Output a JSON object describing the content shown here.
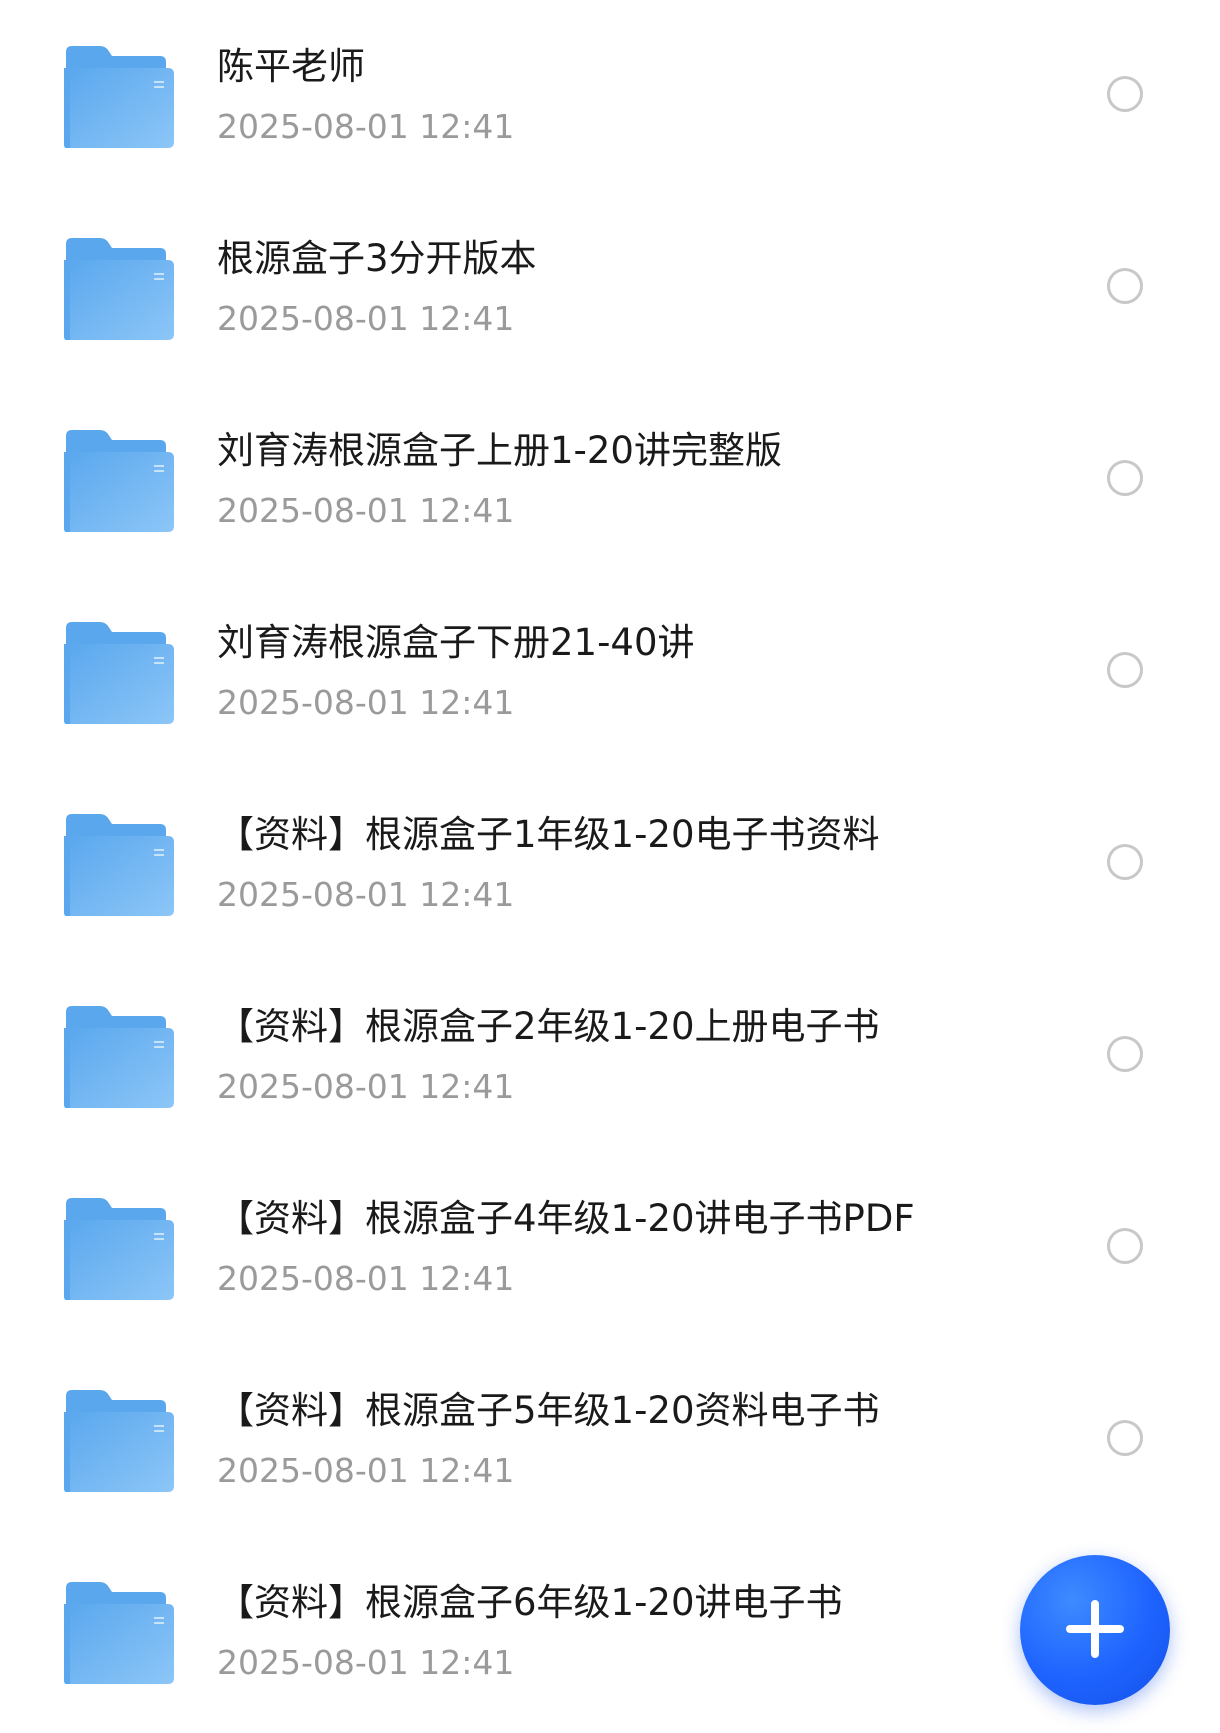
{
  "colors": {
    "folder_back": "#5aa7ee",
    "folder_front": "#8cc6f7",
    "title_text": "#1a1a1a",
    "date_text": "#9a9a9a",
    "radio_border": "#c8c8c8",
    "fab_blue": "#1e63ff"
  },
  "icons": {
    "folder": "folder-icon",
    "select": "radio-unchecked-icon",
    "fab": "plus-icon"
  },
  "files": [
    {
      "name": "陈平老师",
      "date": "2025-08-01 12:41"
    },
    {
      "name": "根源盒子3分开版本",
      "date": "2025-08-01 12:41"
    },
    {
      "name": "刘育涛根源盒子上册1-20讲完整版",
      "date": "2025-08-01 12:41"
    },
    {
      "name": "刘育涛根源盒子下册21-40讲",
      "date": "2025-08-01 12:41"
    },
    {
      "name": "【资料】根源盒子1年级1-20电子书资料",
      "date": "2025-08-01 12:41"
    },
    {
      "name": "【资料】根源盒子2年级1-20上册电子书",
      "date": "2025-08-01 12:41"
    },
    {
      "name": "【资料】根源盒子4年级1-20讲电子书PDF",
      "date": "2025-08-01 12:41"
    },
    {
      "name": "【资料】根源盒子5年级1-20资料电子书",
      "date": "2025-08-01 12:41"
    },
    {
      "name": "【资料】根源盒子6年级1-20讲电子书",
      "date": "2025-08-01 12:41"
    }
  ]
}
